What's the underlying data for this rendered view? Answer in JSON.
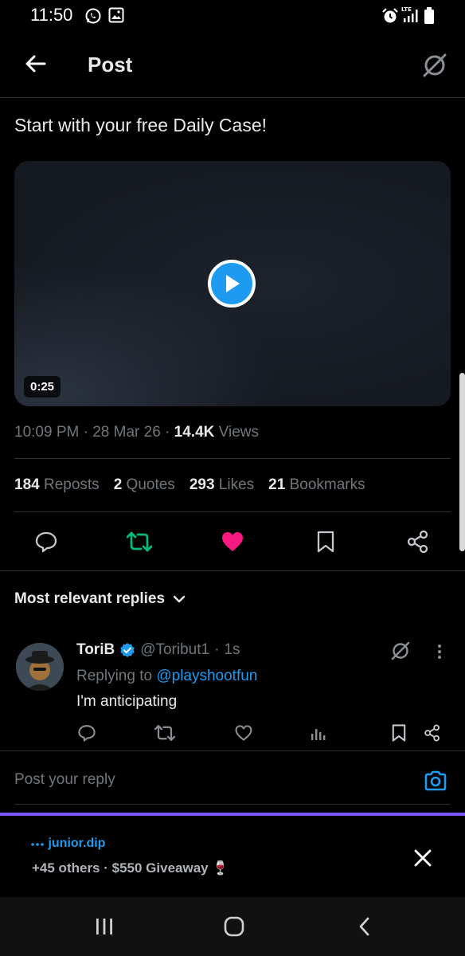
{
  "status_bar": {
    "time": "11:50",
    "icons": [
      "whatsapp-icon",
      "gallery-icon",
      "alarm-icon",
      "lte-signal-icon",
      "battery-icon"
    ],
    "network": "LTE"
  },
  "header": {
    "title": "Post",
    "back_icon": "arrow-left-icon",
    "grok_icon": "grok-icon"
  },
  "post": {
    "text": "Start with your free Daily Case!",
    "video": {
      "duration": "0:25"
    },
    "time": "10:09 PM",
    "date": "28 Mar 26",
    "views_count": "14.4K",
    "views_label": "Views"
  },
  "stats": [
    {
      "count": "184",
      "label": "Reposts"
    },
    {
      "count": "2",
      "label": "Quotes"
    },
    {
      "count": "293",
      "label": "Likes"
    },
    {
      "count": "21",
      "label": "Bookmarks"
    }
  ],
  "actions": {
    "liked": true,
    "reposted": true,
    "colors": {
      "repost": "#00ba7c",
      "like": "#f91880",
      "accent": "#1d9bf0"
    }
  },
  "replies": {
    "sort_label": "Most relevant replies",
    "items": [
      {
        "name": "ToriB",
        "verified": true,
        "handle": "@Toribut1",
        "time": "1s",
        "replying_prefix": "Replying to",
        "replying_to": "@playshootfun",
        "text": "I'm anticipating"
      }
    ]
  },
  "composer": {
    "placeholder": "Post your reply"
  },
  "promo": {
    "user": "junior.dip",
    "text": "+45 others · $550 Giveaway 🍷",
    "accent": "#7856ff"
  },
  "navbar": {
    "buttons": [
      "recents",
      "home",
      "back"
    ]
  }
}
